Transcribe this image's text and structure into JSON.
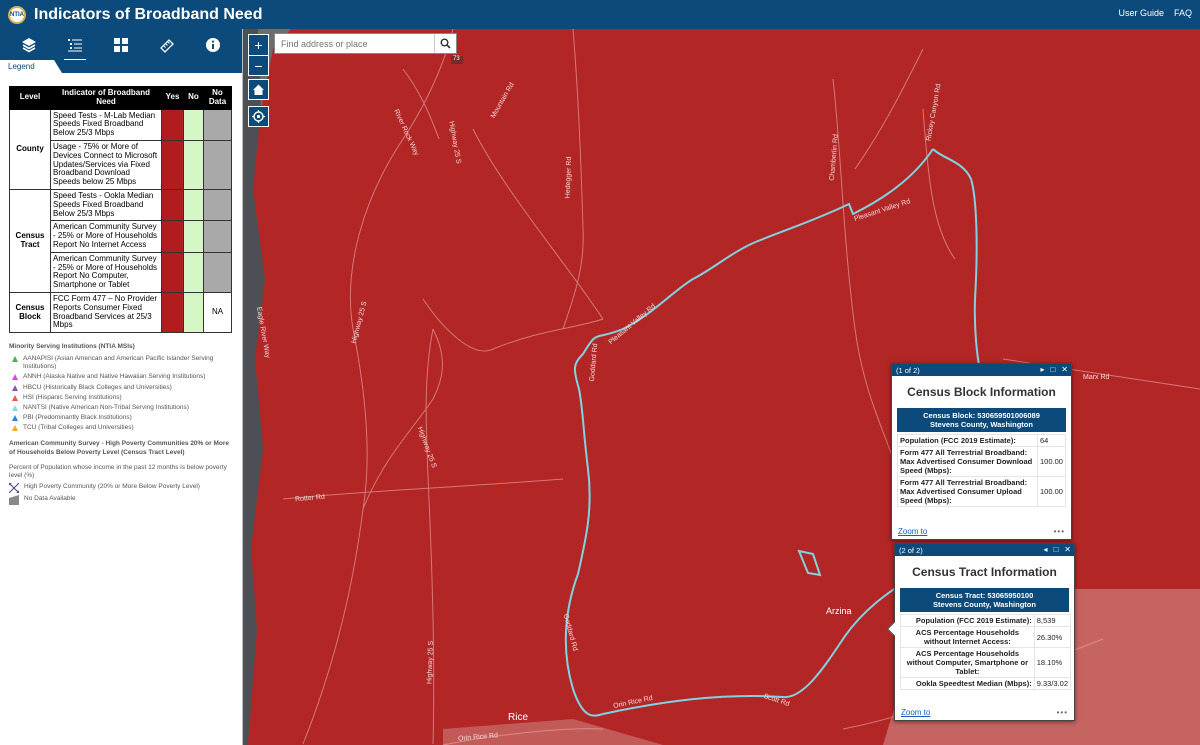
{
  "header": {
    "title": "Indicators of Broadband Need",
    "links": [
      "User Guide",
      "FAQ"
    ]
  },
  "sidebar": {
    "tools": [
      "layers-icon",
      "legend-list-icon",
      "basemap-grid-icon",
      "measure-icon",
      "info-icon"
    ],
    "active_tab": "Legend",
    "table": {
      "headers": [
        "Level",
        "Indicator of Broadband Need",
        "Yes",
        "No",
        "No Data"
      ],
      "groups": [
        {
          "level": "County",
          "rows": [
            "Speed Tests - M-Lab Median Speeds Fixed Broadband Below 25/3 Mbps",
            "Usage - 75% or More of Devices Connect to Microsoft Updates/Services via Fixed Broadband Download Speeds below 25 Mbps"
          ]
        },
        {
          "level": "Census Tract",
          "rows": [
            "Speed Tests - Ookla Median Speeds Fixed Broadband Below 25/3 Mbps",
            "American Community Survey - 25% or More of Households Report No Internet Access",
            "American Community Survey - 25% or More of Households Report No Computer, Smartphone or Tablet"
          ]
        },
        {
          "level": "Census Block",
          "rows": [
            "FCC Form 477 – No Provider Reports Consumer Fixed Broadband Services at 25/3 Mbps"
          ],
          "nodata": "NA"
        }
      ]
    },
    "msi": {
      "title": "Minority Serving Institutions (NTIA MSIs)",
      "items": [
        {
          "label": "AANAPISI (Asian American and American Pacific Islander Serving Institutions)",
          "color": "#4caf50"
        },
        {
          "label": "ANNH (Alaska Native and Native Hawaiian Serving Institutions)",
          "color": "#e040fb"
        },
        {
          "label": "HBCU (Historically Black Colleges and Universities)",
          "color": "#7e57c2"
        },
        {
          "label": "HSI (Hispanic Serving Institutions)",
          "color": "#ef5350"
        },
        {
          "label": "NANTSI (Native American Non-Tribal Serving Institutions)",
          "color": "#80deea"
        },
        {
          "label": "PBI (Predominantly Black Institutions)",
          "color": "#1e88e5"
        },
        {
          "label": "TCU (Tribal Colleges and Universities)",
          "color": "#f9a825"
        }
      ]
    },
    "poverty": {
      "title": "American Community Survey - High Poverty Communities 20% or More of Households Below Poverty Level (Census Tract Level)",
      "desc": "Percent of Population whose income in the past 12 months is below poverty level (%)",
      "items": [
        "High Poverty Community (20% or More Below Poverty Level)",
        "No Data Available"
      ]
    }
  },
  "map": {
    "search_placeholder": "Find address or place",
    "road_labels": [
      "Mountain Rd",
      "River Rock Way",
      "Highway 25 S",
      "Hedegger Rd",
      "Chamberlin Rd",
      "Rickey Canyon Rd",
      "Pleasant Valley Rd",
      "Marx Rd",
      "Highway 25 S",
      "Eagle River Way",
      "Pleasant Valley Rd",
      "Goddard Rd",
      "Highway 25 S",
      "Rotter Rd",
      "Goddard Rd",
      "Highway 25 S",
      "Orin Rice Rd",
      "Scott Rd",
      "Orin Rice Rd",
      "Rice",
      "73"
    ],
    "town": "Arzina"
  },
  "popup1": {
    "pager": "(1 of 2)",
    "title": "Census Block Information",
    "band": [
      "Census Block: 530659501006089",
      "Stevens County, Washington"
    ],
    "rows": [
      {
        "k": "Population (FCC 2019 Estimate):",
        "v": "64"
      },
      {
        "k": "Form 477 All Terrestrial Broadband: Max Advertised Consumer Download Speed (Mbps):",
        "v": "100.00"
      },
      {
        "k": "Form 477 All Terrestrial Broadband: Max Advertised Consumer Upload Speed (Mbps):",
        "v": "100.00"
      }
    ],
    "zoom": "Zoom to",
    "more": "•••"
  },
  "popup2": {
    "pager": "(2 of 2)",
    "title": "Census Tract Information",
    "band": [
      "Census Tract: 53065950100",
      "Stevens County, Washington"
    ],
    "rows": [
      {
        "k": "Population (FCC 2019 Estimate):",
        "v": "8,539"
      },
      {
        "k": "ACS Percentage Households without Internet Access:",
        "v": "26.30%"
      },
      {
        "k": "ACS Percentage Households without Computer, Smartphone or Tablet:",
        "v": "18.10%"
      },
      {
        "k": "Ookla Speedtest Median (Mbps):",
        "v": "9.33/3.02"
      }
    ],
    "zoom": "Zoom to",
    "more": "•••"
  },
  "colors": {
    "brand": "#0b4a7a",
    "yes": "#b31c1c",
    "no": "#d4f7c5",
    "nodata": "#a9a9a9",
    "map": "#b32626",
    "road": "#7fd3e0"
  }
}
